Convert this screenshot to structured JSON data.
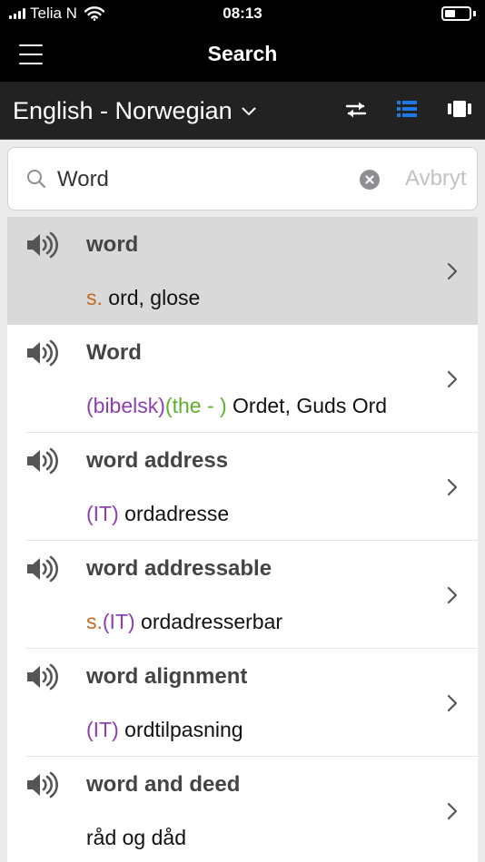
{
  "status_bar": {
    "carrier": "Telia N",
    "time": "08:13",
    "battery_level": 0.42
  },
  "nav": {
    "title": "Search"
  },
  "language_bar": {
    "selected_pair": "English - Norwegian"
  },
  "search": {
    "value": "Word",
    "cancel_label": "Avbryt"
  },
  "colors": {
    "part_of_speech": "#c16a1e",
    "domain_label": "#8b3fb0",
    "usage_label": "#5fae2e",
    "active_view_icon": "#1a7be8",
    "selected_row": "#d9d9d9"
  },
  "results": [
    {
      "headword": "word",
      "pos": "s.",
      "domain": "",
      "usage": "",
      "translation": "ord, glose",
      "selected": true
    },
    {
      "headword": "Word",
      "pos": "",
      "domain": "(bibelsk)",
      "usage": "(the - )",
      "translation": "Ordet, Guds Ord",
      "selected": false
    },
    {
      "headword": "word address",
      "pos": "",
      "domain": "(IT)",
      "usage": "",
      "translation": "ordadresse",
      "selected": false
    },
    {
      "headword": "word addressable",
      "pos": "s.",
      "domain": "(IT)",
      "usage": "",
      "translation": "ordadresserbar",
      "selected": false
    },
    {
      "headword": "word alignment",
      "pos": "",
      "domain": "(IT)",
      "usage": "",
      "translation": "ordtilpasning",
      "selected": false
    },
    {
      "headword": "word and deed",
      "pos": "",
      "domain": "",
      "usage": "",
      "translation": " råd og dåd",
      "selected": false
    }
  ]
}
